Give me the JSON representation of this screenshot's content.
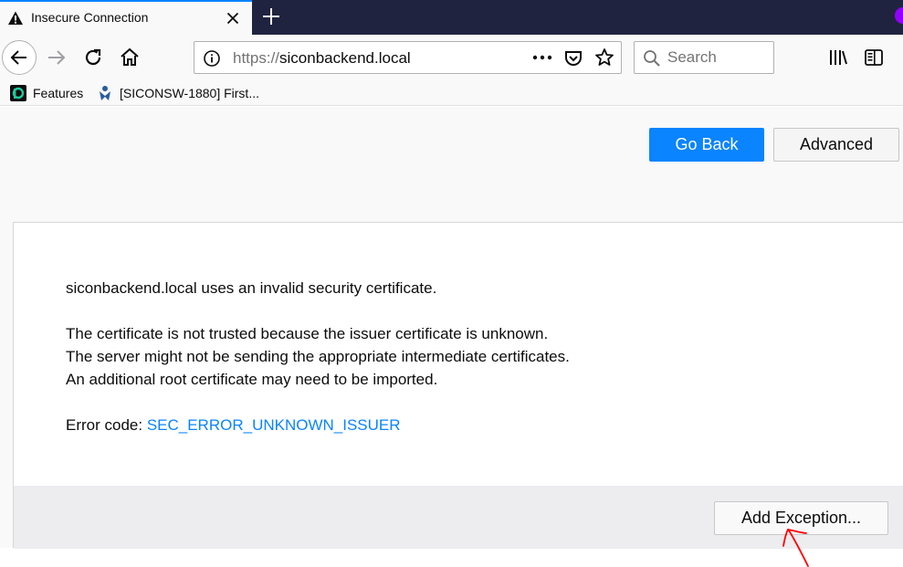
{
  "tab": {
    "title": "Insecure Connection"
  },
  "urlbar": {
    "scheme": "https://",
    "host": "siconbackend.local"
  },
  "search": {
    "placeholder": "Search"
  },
  "bookmarks": [
    {
      "label": "Features"
    },
    {
      "label": "[SICONSW-1880] First..."
    }
  ],
  "actions": {
    "go_back": "Go Back",
    "advanced": "Advanced"
  },
  "error": {
    "line1": "siconbackend.local uses an invalid security certificate.",
    "line2": "The certificate is not trusted because the issuer certificate is unknown.",
    "line3": "The server might not be sending the appropriate intermediate certificates.",
    "line4": "An additional root certificate may need to be imported.",
    "code_label": "Error code: ",
    "code": "SEC_ERROR_UNKNOWN_ISSUER"
  },
  "footer": {
    "add_exception": "Add Exception..."
  },
  "colors": {
    "accent": "#0a84ff",
    "tabstrip": "#202340",
    "annotation": "#ff0000"
  }
}
